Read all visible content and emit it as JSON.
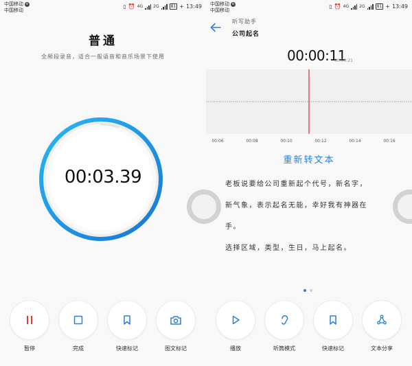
{
  "status_bar": {
    "carrier_1": "中国移动",
    "carrier_2": "中国移动",
    "carrier_badge": "e",
    "network_1": "4G",
    "network_2": "2G",
    "battery": "81",
    "time": "13:49"
  },
  "recording": {
    "mode_title": "普通",
    "mode_description": "全频段录音，适合一般语音和音乐场景下使用",
    "elapsed": "00:03.39",
    "progress": 0.05
  },
  "recording_actions": [
    {
      "label": "暂停",
      "icon": "pause-icon"
    },
    {
      "label": "完成",
      "icon": "stop-icon"
    },
    {
      "label": "快速标记",
      "icon": "bookmark-icon"
    },
    {
      "label": "图文标记",
      "icon": "camera-icon"
    }
  ],
  "playback": {
    "subtitle": "听写助手",
    "title": "公司起名",
    "current_time": "00:00:11",
    "total_time": "00:00:21",
    "timeline_ticks": [
      "00:06",
      "00:08",
      "00:10",
      "00:12",
      "00:14",
      "00:16"
    ],
    "reconvert_label": "重新转文本",
    "transcript_lines": [
      "老板说要给公司重新起个代号，新名字，",
      "新气象，表示起名无能，幸好我有神器在",
      "手。",
      "选择区域，类型，生日，马上起名。"
    ],
    "page_count": 2,
    "active_page": 1
  },
  "playback_actions": [
    {
      "label": "播放",
      "icon": "play-icon"
    },
    {
      "label": "听筒模式",
      "icon": "ear-icon"
    },
    {
      "label": "快速标记",
      "icon": "bookmark-icon"
    },
    {
      "label": "文本分享",
      "icon": "share-icon"
    }
  ],
  "colors": {
    "accent": "#2a7fdc",
    "pause_red": "#e53935",
    "playhead": "#d32f2f",
    "dial_gradient_start": "#29b6f6",
    "dial_gradient_end": "#1976d2"
  }
}
